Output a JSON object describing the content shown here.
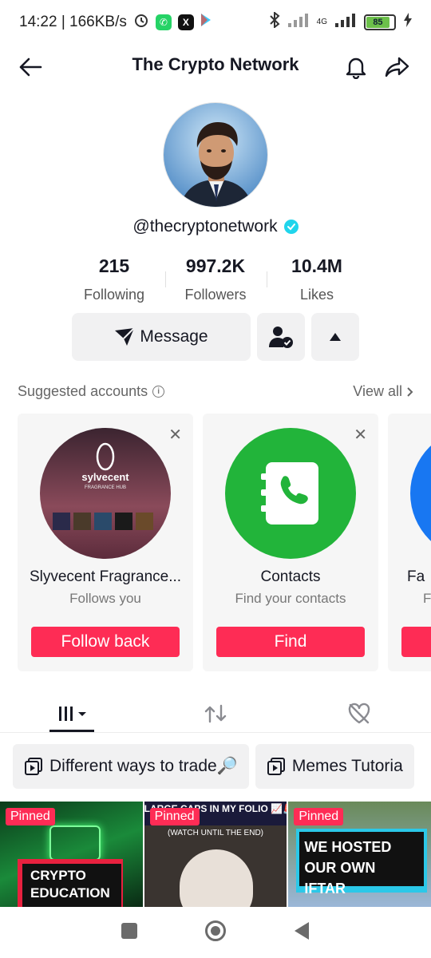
{
  "status_bar": {
    "time_speed": "14:22 | 166KB/s",
    "network_label": "4G",
    "battery": "85",
    "battery_level": 0.85
  },
  "header": {
    "title": "The Crypto Network"
  },
  "profile": {
    "handle": "@thecryptonetwork",
    "stats": [
      {
        "num": "215",
        "label": "Following"
      },
      {
        "num": "997.2K",
        "label": "Followers"
      },
      {
        "num": "10.4M",
        "label": "Likes"
      }
    ],
    "message_label": "Message"
  },
  "suggested": {
    "heading": "Suggested accounts",
    "view_all": "View all",
    "cards": [
      {
        "name": "Slyvecent Fragrance...",
        "sub": "Follows you",
        "cta": "Follow back",
        "logo_text": "sylvecent",
        "logo_sub": "FRAGRANCE HUB"
      },
      {
        "name": "Contacts",
        "sub": "Find your contacts",
        "cta": "Find"
      },
      {
        "name": "Fa",
        "sub": "Fi"
      }
    ]
  },
  "playlists": [
    {
      "label": "Different ways to trade🔎"
    },
    {
      "label": "Memes Tutoria"
    }
  ],
  "videos": [
    {
      "pinned": "Pinned",
      "caption": "CRYPTO EDUCATION"
    },
    {
      "pinned": "Pinned",
      "top_text": "LARGE CAPS IN MY FOLIO 📈🚨",
      "sub_text": "(WATCH UNTIL THE END)"
    },
    {
      "pinned": "Pinned",
      "caption": "WE HOSTED OUR OWN IFTAR"
    }
  ]
}
